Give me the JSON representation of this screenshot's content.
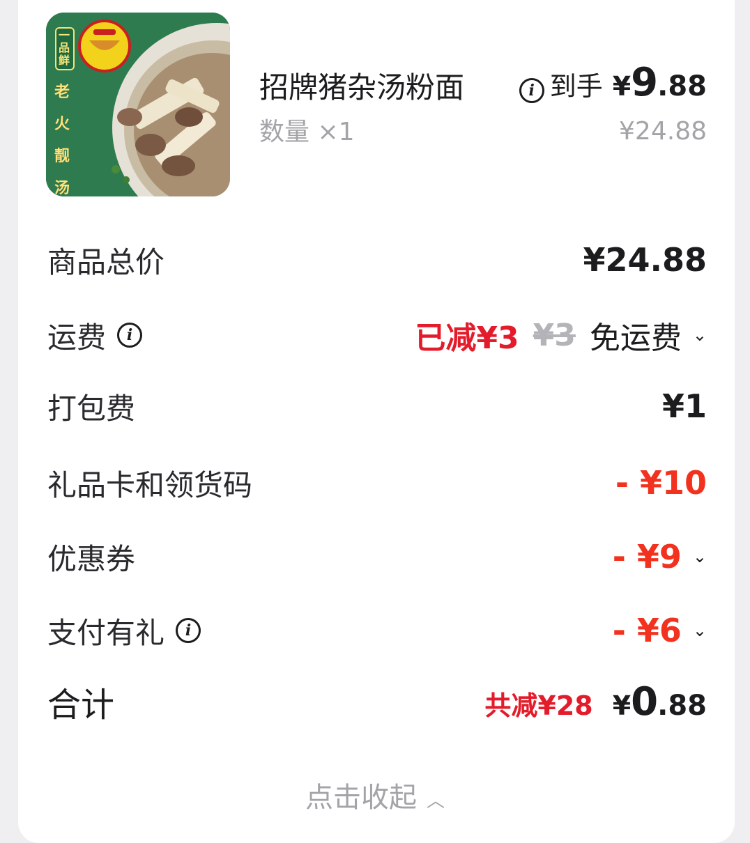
{
  "item": {
    "name": "招牌猪杂汤粉面",
    "qty": "数量 ×1",
    "final_label": "到手",
    "final_yen": "¥",
    "final_int": "9",
    "final_dec": ".88",
    "orig_price": "¥24.88",
    "image_alt": "招牌猪杂汤粉面",
    "image_badge_top": "一品鲜",
    "image_badge_side": "老火靓汤"
  },
  "rows": {
    "goods_total": {
      "label": "商品总价",
      "value": "¥24.88"
    },
    "shipping": {
      "label": "运费",
      "discount": "已减¥3",
      "original": "¥3",
      "value": "免运费"
    },
    "packing": {
      "label": "打包费",
      "value": "¥1"
    },
    "gift_card": {
      "label": "礼品卡和领货码",
      "value": "- ¥10"
    },
    "coupon": {
      "label": "优惠券",
      "value": "- ¥9"
    },
    "pay_gift": {
      "label": "支付有礼",
      "value": "- ¥6"
    }
  },
  "total": {
    "label": "合计",
    "saved": "共减¥28",
    "yen": "¥",
    "int": "0",
    "dec": ".88"
  },
  "collapse": {
    "label": "点击收起"
  },
  "colors": {
    "red": "#e41b2a",
    "muted": "#a4a4a8",
    "text": "#1c1c1e"
  }
}
